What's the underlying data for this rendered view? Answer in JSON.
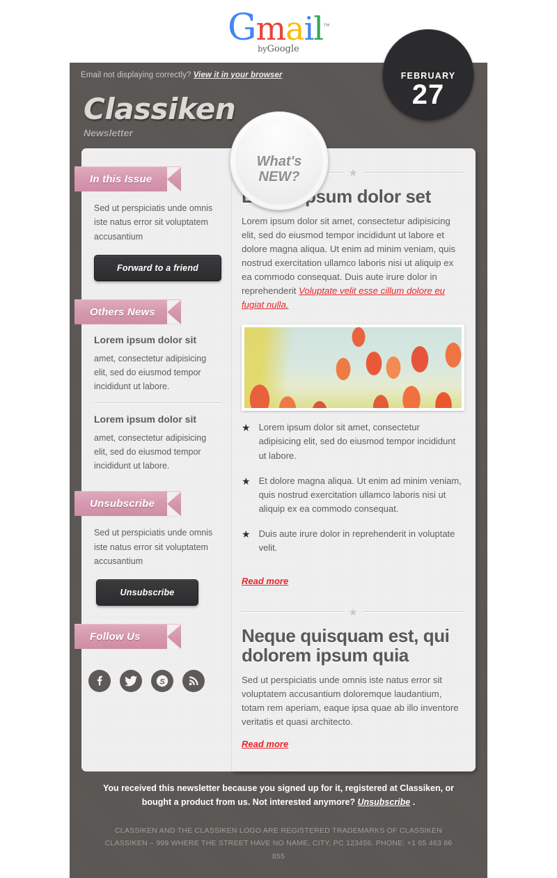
{
  "gmail": {
    "g": "G",
    "m": "m",
    "a": "a",
    "i": "i",
    "l": "l",
    "tm": "™",
    "by": "by",
    "google": "Google"
  },
  "topnote": {
    "text": "Email not displaying correctly?",
    "link": "View it in your browser"
  },
  "date": {
    "month": "FEBRUARY",
    "day": "27"
  },
  "brand": {
    "title": "Classiken",
    "subtitle": "Newsletter"
  },
  "whats_new": {
    "line1": "What's",
    "line2": "NEW?"
  },
  "sidebar": {
    "sections": [
      {
        "ribbon": "In this Issue",
        "text": "Sed ut perspiciatis unde omnis iste natus error sit voluptatem accusantium",
        "button": "Forward to a friend"
      },
      {
        "ribbon": "Others News",
        "items": [
          {
            "head": "Lorem ipsum dolor sit",
            "para": "amet, consectetur adipisicing elit, sed do eiusmod tempor incididunt ut labore."
          },
          {
            "head": "Lorem ipsum dolor sit",
            "para": "amet, consectetur adipisicing elit, sed do eiusmod tempor incididunt ut labore."
          }
        ]
      },
      {
        "ribbon": "Unsubscribe",
        "text": "Sed ut perspiciatis unde omnis iste natus error sit voluptatem accusantium",
        "button": "Unsubscribe"
      },
      {
        "ribbon": "Follow Us",
        "socials": [
          {
            "name": "facebook-icon",
            "glyph": "f"
          },
          {
            "name": "twitter-icon",
            "glyph": "t"
          },
          {
            "name": "skype-icon",
            "glyph": "S"
          },
          {
            "name": "rss-icon",
            "glyph": "r"
          }
        ]
      }
    ]
  },
  "main": {
    "articles": [
      {
        "title": "Lorem ipsum dolor set",
        "body_lead": "Lorem ipsum dolor sit amet, consectetur adipisicing elit, sed do eiusmod tempor incididunt ut labore et dolore magna aliqua. Ut enim ad minim veniam, quis nostrud exercitation ullamco laboris nisi ut aliquip ex ea commodo consequat. Duis aute irure dolor in reprehenderit ",
        "body_link": "Voluptate velit esse cillum dolore eu fugiat nulla.",
        "image_alt": "tulips-photo",
        "bullets": [
          "Lorem ipsum dolor sit amet, consectetur adipisicing elit, sed do eiusmod tempor incididunt ut labore.",
          "Et dolore magna aliqua. Ut enim ad minim veniam, quis nostrud exercitation ullamco laboris nisi ut aliquip ex ea commodo consequat.",
          "Duis aute irure dolor in reprehenderit in voluptate velit."
        ],
        "read_more": "Read more"
      },
      {
        "title": "Neque quisquam est, qui dolorem ipsum quia",
        "body_lead": "Sed ut perspiciatis unde omnis iste natus error sit voluptatem accusantium doloremque laudantium, totam rem aperiam, eaque ipsa quae ab illo inventore veritatis et quasi architecto.",
        "read_more": "Read more"
      }
    ],
    "star_ornament": "★"
  },
  "footer": {
    "main_pre": "You received this newsletter because you signed up for it, registered at Classiken, or bought a product from us. Not interested anymore? ",
    "main_link": "Unsubscribe",
    "main_post": " .",
    "small_line1": "CLASSIKEN AND THE CLASSIKEN LOGO ARE REGISTERED TRADEMARKS OF CLASSIKEN",
    "small_line2": "CLASSIKEN – 999 WHERE THE STREET HAVE NO NAME, CITY, PC 123456. PHONE: +1 65 463 86 855"
  },
  "colors": {
    "dark_bg": "#5a5653",
    "ribbon_pink": "#d693ab",
    "link_red": "#e8242a",
    "paper": "#f1f1f1",
    "badge_dark": "#2b2b2d"
  }
}
